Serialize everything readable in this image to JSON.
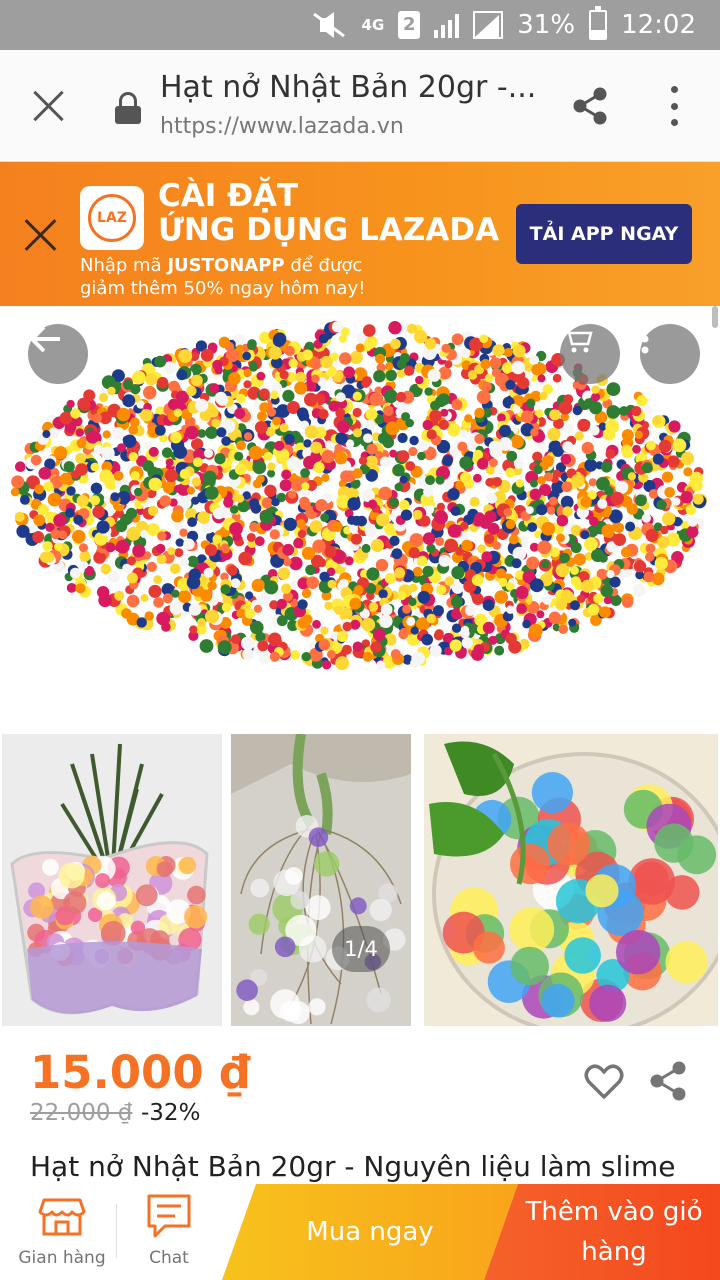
{
  "status_bar": {
    "network": "4G",
    "sim": "2",
    "battery": "31%",
    "time": "12:02"
  },
  "browser": {
    "title": "Hạt nở Nhật Bản 20gr -...",
    "url": "https://www.lazada.vn"
  },
  "promo": {
    "logo_text": "LAZ",
    "line1": "CÀI ĐẶT",
    "line2": "ỨNG DỤNG LAZADA",
    "sub1_pre": "Nhập mã ",
    "sub1_code": "JUSTONAPP",
    "sub1_post": " để được",
    "sub2": "giảm thêm 50% ngay hôm nay!",
    "cta": "TẢI APP NGAY"
  },
  "gallery": {
    "pager": "1/4"
  },
  "product": {
    "price": "15.000 ₫",
    "old_price": "22.000 ₫",
    "discount": "-32%",
    "title": "Hạt nở Nhật Bản 20gr - Nguyên liệu làm slime"
  },
  "bottom_bar": {
    "shop_label": "Gian hàng",
    "chat_label": "Chat",
    "buy_now": "Mua ngay",
    "add_to_cart_line1": "Thêm vào giỏ",
    "add_to_cart_line2": "hàng"
  },
  "colors": {
    "accent": "#f57224",
    "buy_now": "#f9b31b",
    "add_to_cart": "#f4511e",
    "promo_cta": "#2b2e7a"
  },
  "icons": [
    "close-icon",
    "lock-icon",
    "share-icon",
    "more-icon",
    "back-arrow-icon",
    "cart-icon",
    "heart-icon",
    "store-icon",
    "chat-icon"
  ]
}
